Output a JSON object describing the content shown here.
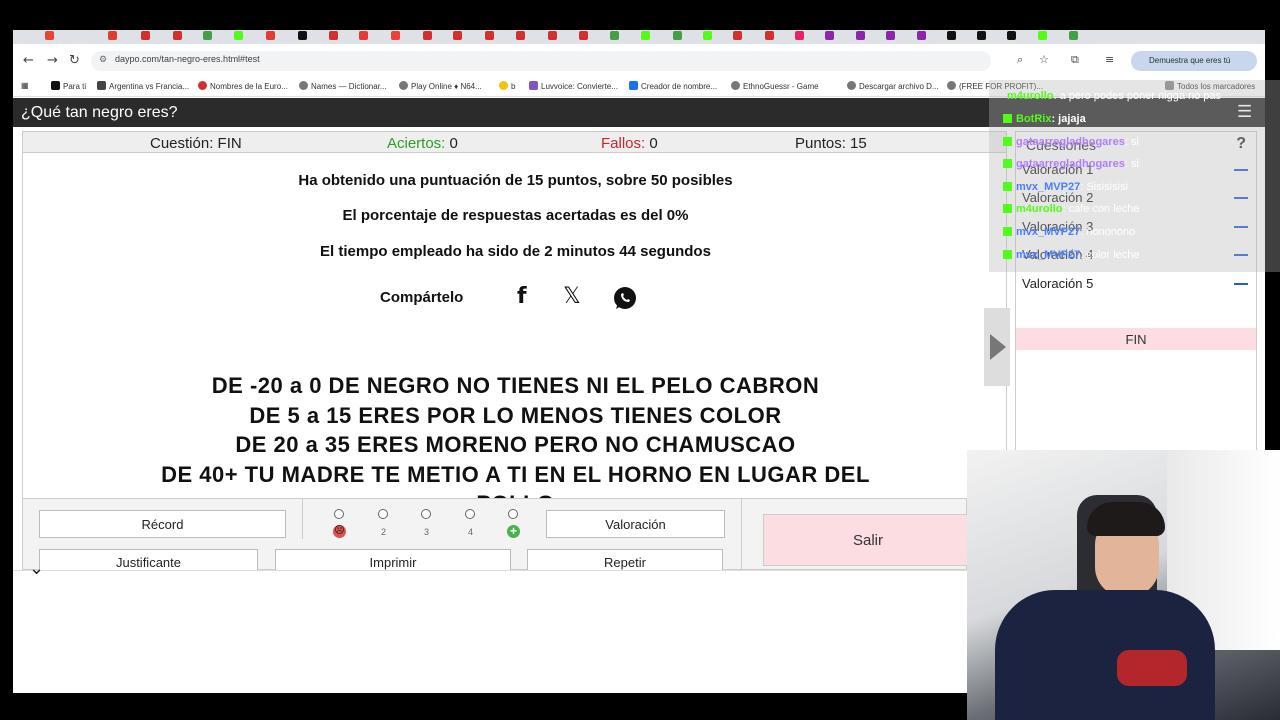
{
  "browser": {
    "url": "daypo.com/tan-negro-eres.html#test",
    "top_right_chip": "Demuestra que eres tú",
    "bookmarks": [
      "Para ti",
      "Argentina vs Francia...",
      "Nombres de la Euro...",
      "Names — Dictionar...",
      "Play Online ♦ N64...",
      "b",
      "Luvvoice: Convierte...",
      "Creador de nombre...",
      "EthnoGuessr - Game",
      "Descargar archivo D...",
      "(FREE FOR PROFIT)...",
      "Todos los marcadores"
    ]
  },
  "page": {
    "title": "¿Qué tan negro eres?",
    "stats": {
      "question_label": "Cuestión: FIN",
      "hits_label": "Aciertos:",
      "hits_value": "0",
      "fails_label": "Fallos:",
      "fails_value": "0",
      "points_label": "Puntos: 15"
    },
    "results": {
      "line1": "Ha obtenido una puntuación de 15 puntos, sobre 50 posibles",
      "line2": "El porcentaje de respuestas acertadas es del 0%",
      "line3": "El tiempo empleado ha sido de 2 minutos 44 segundos",
      "share_label": "Compártelo"
    },
    "scale_text": [
      "DE -20 a 0 DE NEGRO NO TIENES NI EL PELO CABRON",
      "DE 5 a 15 ERES POR LO MENOS TIENES COLOR",
      "DE 20 a 35 ERES MORENO PERO NO CHAMUSCAO",
      "DE 40+ TU MADRE TE METIO A TI EN EL HORNO EN LUGAR DEL",
      "POLLO"
    ],
    "buttons": {
      "record": "Récord",
      "rating": "Valoración",
      "exit": "Salir",
      "receipt": "Justificante",
      "print": "Imprimir",
      "repeat": "Repetir"
    },
    "rating_numbers": [
      "2",
      "3",
      "4"
    ],
    "side_panel": {
      "heading": "Cuestiones",
      "help": "?",
      "items": [
        "Valoración 1",
        "Valoración 2",
        "Valoración 3",
        "Valoración 4",
        "Valoración 5"
      ],
      "end_label": "FIN"
    }
  },
  "chat": [
    {
      "user": "m4urollo",
      "text": ": a pero podes poner nigga no pas",
      "color": "#53fc18"
    },
    {
      "user": "BotRix",
      "text": ": jajaja",
      "color": "#53fc18"
    },
    {
      "user": "gataarregladhogares",
      "text": ": si",
      "color": "#b07cff"
    },
    {
      "user": "gataarregladhogares",
      "text": ": si",
      "color": "#b07cff"
    },
    {
      "user": "mvx_MVP27",
      "text": ": Sisisisisi",
      "color": "#4a7dff"
    },
    {
      "user": "m4urollo",
      "text": ": cafe con leche",
      "color": "#53fc18"
    },
    {
      "user": "mvx_MVP27",
      "text": ": nononono",
      "color": "#4a7dff"
    },
    {
      "user": "mvx_MVP27",
      "text": ": color leche",
      "color": "#4a7dff"
    }
  ]
}
